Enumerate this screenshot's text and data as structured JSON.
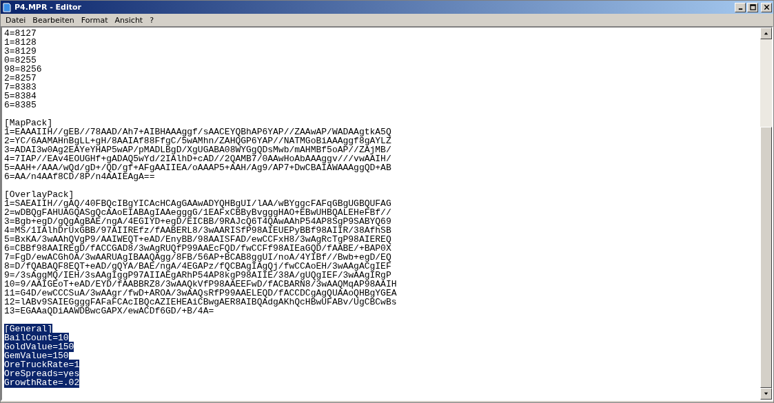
{
  "window": {
    "title": "P4.MPR - Editor"
  },
  "menu": [
    "Datei",
    "Bearbeiten",
    "Format",
    "Ansicht",
    "?"
  ],
  "blocks": [
    {
      "lines": [
        {
          "text": "4=8127",
          "selected": false
        },
        {
          "text": "1=8128",
          "selected": false
        },
        {
          "text": "3=8129",
          "selected": false
        },
        {
          "text": "0=8255",
          "selected": false
        },
        {
          "text": "98=8256",
          "selected": false
        },
        {
          "text": "2=8257",
          "selected": false
        },
        {
          "text": "7=8383",
          "selected": false
        },
        {
          "text": "5=8384",
          "selected": false
        },
        {
          "text": "6=8385",
          "selected": false
        }
      ]
    },
    {
      "lines": [
        {
          "text": "[MapPack]",
          "selected": false
        },
        {
          "text": "1=EAAAIIH//gEB//78AAD/Ah7+AIBHAAAggf/sAACEYQBhAP6YAP//ZAAwAP/WADAAgtkA5Q",
          "selected": false
        },
        {
          "text": "2=YC/6AAMAHnBgLL+gH/8AAIAf88FfgC/5wAMhn/ZAHQGP6YAP//NATMGoBiAAAggf8gAYLZ",
          "selected": false
        },
        {
          "text": "3=ADAI3w0Ag2EAYeYHAP5wAP/pMADLBgD/XgUGABA08WYGgQDsMwb/mAHMBf5oAP//ZAjMB/",
          "selected": false
        },
        {
          "text": "4=7IAP//EAv4EOUGHf+gADAQ5wYd/2IAlhD+cAD//2QAMB7/0AAwHoAbAAAggv///vwAAIH/",
          "selected": false
        },
        {
          "text": "5=AAH+/AAA/wQd/gD+/QD/gf+AFgAAIIEA/oAAAP5+AAH/Ag9/AP7+DwCBAIAWAAAggQD+AB",
          "selected": false
        },
        {
          "text": "6=AA/n4AAf8CD/8P/n4AAIEAgA==",
          "selected": false
        }
      ]
    },
    {
      "lines": [
        {
          "text": "[OverlayPack]",
          "selected": false
        },
        {
          "text": "1=SAEAIIH//gAQ/40FBQcIBgYICAcHCAgGAAwADYQHBgUI/lAA/wBYggcFAFqGBgUGBQUFAG",
          "selected": false
        },
        {
          "text": "2=wDBQgFAHUAGQASgQcAAoEIABAgIAAegggG/1EAFxCBByBvgggHAO+EBwUHBQALEHeFBf//",
          "selected": false
        },
        {
          "text": "3=Bgb+egD/gQgAgBAE/ngA/4EGIYD+egD/EICBB/9RAJcQ6T4QAwAAhP54AP8SgP9SABYQ69",
          "selected": false
        },
        {
          "text": "4=MS/1IAlhDrUxGBB/97AIIREfz/fAABERL8/3wAARISfP98AIEUEPyBBf98AIIR/38AfhSB",
          "selected": false
        },
        {
          "text": "5=BxKA/3wAAhQVgP9/AAIWEQT+eAD/EnyBB/98AAISFAD/ewCCFxH8/3wAgRcTgP98AIEREQ",
          "selected": false
        },
        {
          "text": "6=CBBf98AAIREgD/fACCGAD8/3wAgRUQfP99AAEcFQD/fwCCFf98AIEaGQD/fAABE/+BAP0X",
          "selected": false
        },
        {
          "text": "7=FgD/ewACGhOA/3wAARUAgIBAAQAgg/8FB/56AP+BCAB8ggUI/noA/4YIBf//Bwb+egD/EQ",
          "selected": false
        },
        {
          "text": "8=D/fQABAQF8EQT+eAD/gQYA/BAE/ngA/4EGAPz/fQCBAgIAgQj/fwCCAoEH/3wAAgACgIEF",
          "selected": false
        },
        {
          "text": "9=/3sAggMQ/IEH/3sAAgIggP97AIIAEgARhP54AP8kgP98AIIE/38A/gUQgIEF/3wAAgIRgP",
          "selected": false
        },
        {
          "text": "10=9/AAIGEoT+eAD/EYD/fAABBRZ8/3wAAQkVfP98AAEEFwD/fACBARN8/3wAAQMqAP98AAIH",
          "selected": false
        },
        {
          "text": "11=G4D/ewCCCSuA/3wAAgr/fwD+AROA/3wAAQsRfP99AAELEQD/fACCDCgAgQUAAoQHBgYGEA",
          "selected": false
        },
        {
          "text": "12=lABv9SAIEGgggFAFaFCAcIBQcAZIEHEAiCBwgAER8AIBQAdgAKhQcHBwUFABv/UgCBCwBs",
          "selected": false
        },
        {
          "text": "13=EGAAaQDiAAWDBwcGAPX/ewACDf6GD/+B/4A=",
          "selected": false
        }
      ]
    },
    {
      "lines": [
        {
          "text": "[General]",
          "selected": true
        },
        {
          "text": "BailCount=10",
          "selected": true
        },
        {
          "text": "GoldValue=150",
          "selected": true
        },
        {
          "text": "GemValue=150",
          "selected": true
        },
        {
          "text": "OreTruckRate=1",
          "selected": true
        },
        {
          "text": "OreSpreads=yes",
          "selected": true
        },
        {
          "text": "GrowthRate=.02",
          "selected": true
        }
      ]
    }
  ]
}
